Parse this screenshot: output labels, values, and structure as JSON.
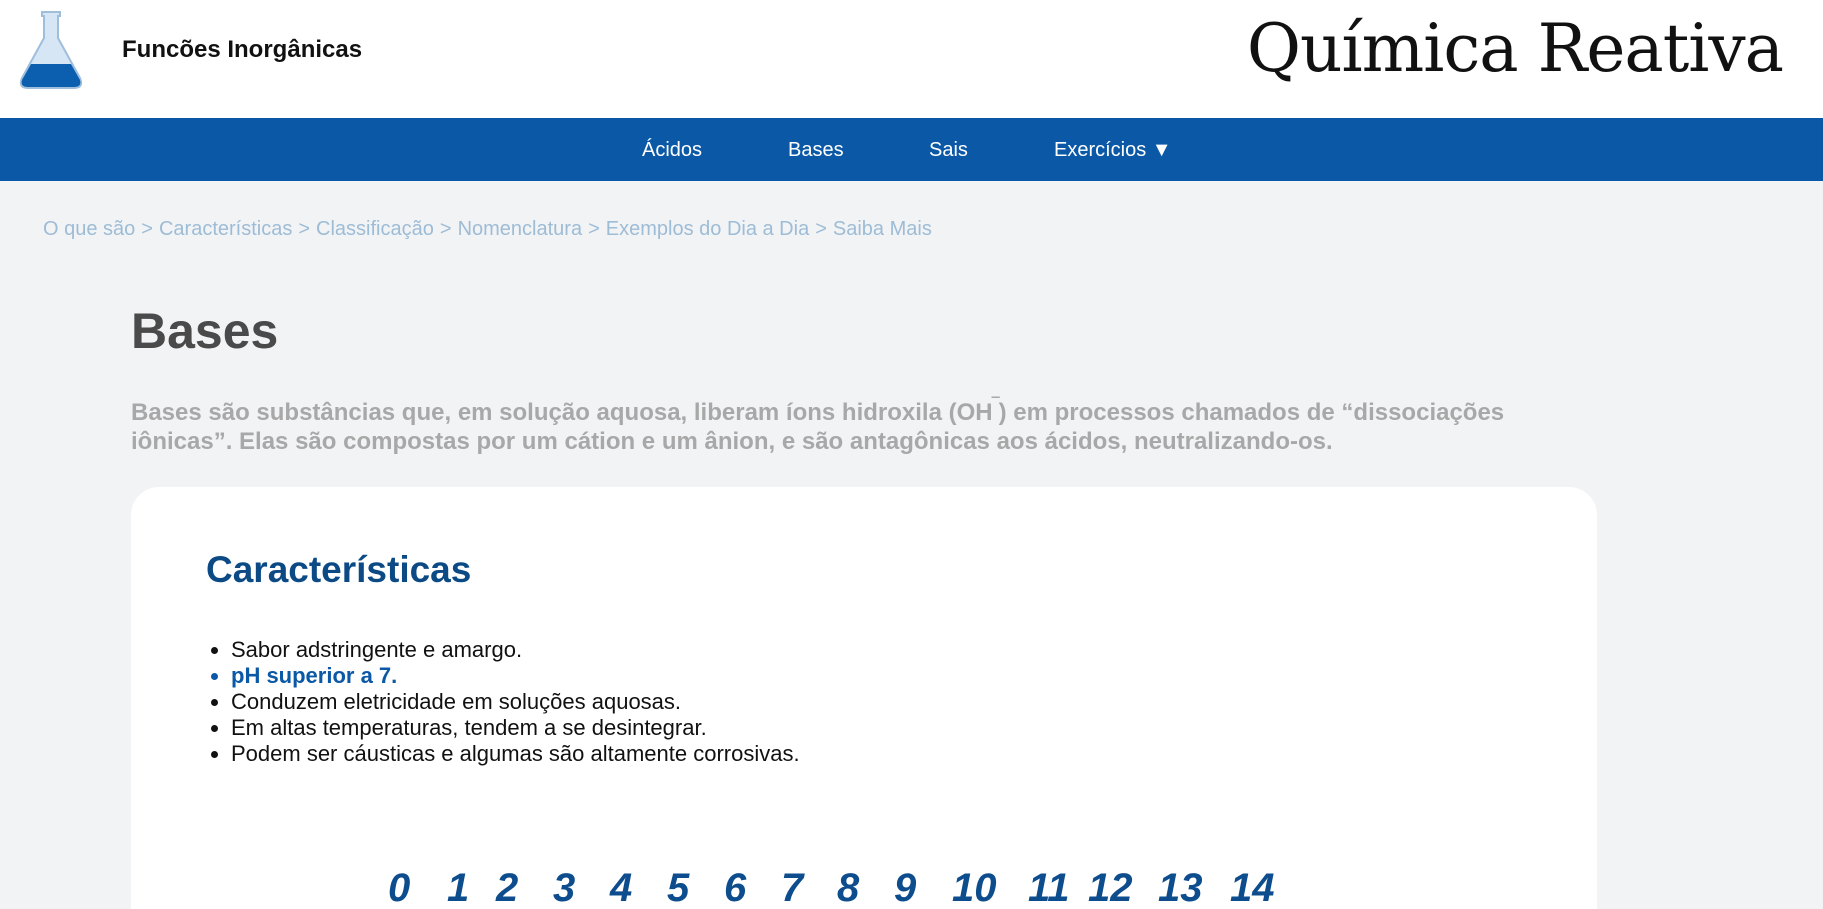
{
  "header": {
    "section_title": "Funcões Inorgânicas",
    "logo_text": "Química Reativa"
  },
  "nav": {
    "items": [
      {
        "label": "Ácidos"
      },
      {
        "label": "Bases"
      },
      {
        "label": "Sais"
      },
      {
        "label": "Exercícios ▼"
      }
    ]
  },
  "breadcrumb": {
    "items": [
      "O que são",
      "Características",
      "Classificação",
      "Nomenclatura",
      "Exemplos do Dia a Dia",
      "Saiba Mais"
    ],
    "separator": ">"
  },
  "main": {
    "title": "Bases",
    "intro_part1": "Bases são substâncias que, em solução aquosa, liberam íons hidroxila (OH",
    "intro_sup": "‾",
    "intro_part2": ") em processos chamados de “dissociações iônicas”. Elas são compostas por um cátion e um ânion, e são antagônicas aos ácidos, neutralizando-os."
  },
  "characteristics": {
    "title": "Características",
    "items": [
      "Sabor adstringente e amargo.",
      "pH superior a 7.",
      "Conduzem eletricidade em soluções aquosas.",
      "Em altas temperaturas, tendem a se desintegrar.",
      "Podem ser cáusticas e algumas são altamente corrosivas."
    ],
    "highlight_index": 1
  },
  "ph_scale": {
    "numbers": [
      "0",
      "1",
      "2",
      "3",
      "4",
      "5",
      "6",
      "7",
      "8",
      "9",
      "10",
      "11",
      "12",
      "13",
      "14"
    ]
  },
  "colors": {
    "nav_bg": "#0b58a6",
    "title_blue": "#0c4a85",
    "breadcrumb": "#9dbcd6"
  }
}
